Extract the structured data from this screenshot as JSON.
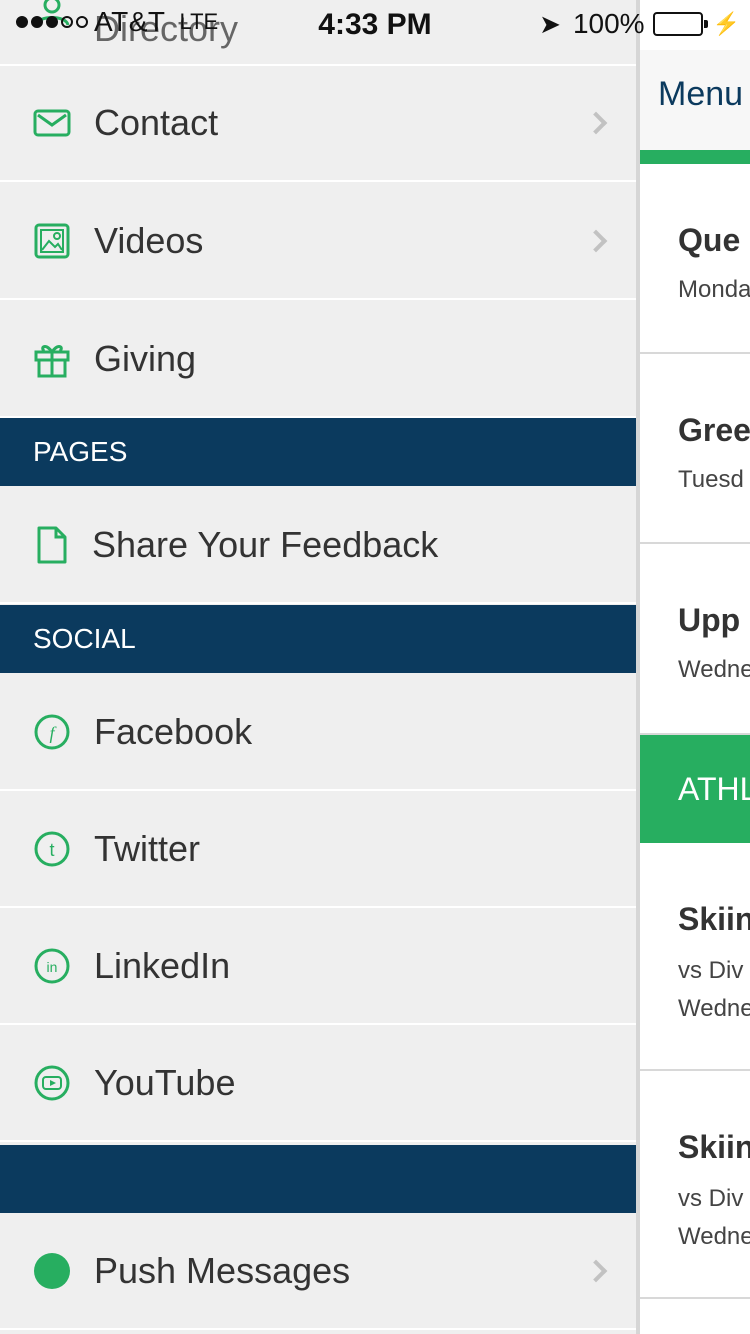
{
  "status_bar": {
    "carrier": "AT&T",
    "network": "LTE",
    "time": "4:33 PM",
    "battery_percent": "100%",
    "battery_level": 1.0
  },
  "menu": {
    "partial_top_label": "Directory",
    "items": [
      {
        "label": "Contact",
        "icon": "mail-icon"
      },
      {
        "label": "Videos",
        "icon": "image-icon"
      },
      {
        "label": "Giving",
        "icon": "gift-icon"
      }
    ],
    "sections": {
      "pages": {
        "header": "PAGES",
        "items": [
          {
            "label": "Share Your Feedback",
            "icon": "document-icon"
          }
        ]
      },
      "social": {
        "header": "SOCIAL",
        "items": [
          {
            "label": "Facebook",
            "icon": "facebook-icon"
          },
          {
            "label": "Twitter",
            "icon": "twitter-icon"
          },
          {
            "label": "LinkedIn",
            "icon": "linkedin-icon"
          },
          {
            "label": "YouTube",
            "icon": "youtube-icon"
          }
        ]
      },
      "other": {
        "header": "",
        "items": [
          {
            "label": "Push Messages",
            "icon": "status-dot-icon"
          }
        ]
      }
    }
  },
  "panel": {
    "nav_label": "Menu",
    "cards_top": [
      {
        "title": "Que",
        "subtitle": "Monda"
      },
      {
        "title": "Gree",
        "subtitle": "Tuesd"
      },
      {
        "title": "Upp",
        "subtitle": "Wedne"
      }
    ],
    "band_label": "ATHL",
    "cards_bottom": [
      {
        "title": "Skiin",
        "line1": "vs Div",
        "line2": "Wedne"
      },
      {
        "title": "Skiin",
        "line1": "vs Div",
        "line2": "Wedne"
      }
    ]
  },
  "colors": {
    "accent_green": "#27ae60",
    "section_navy": "#0b3a5e",
    "menu_bg": "#efefef"
  }
}
